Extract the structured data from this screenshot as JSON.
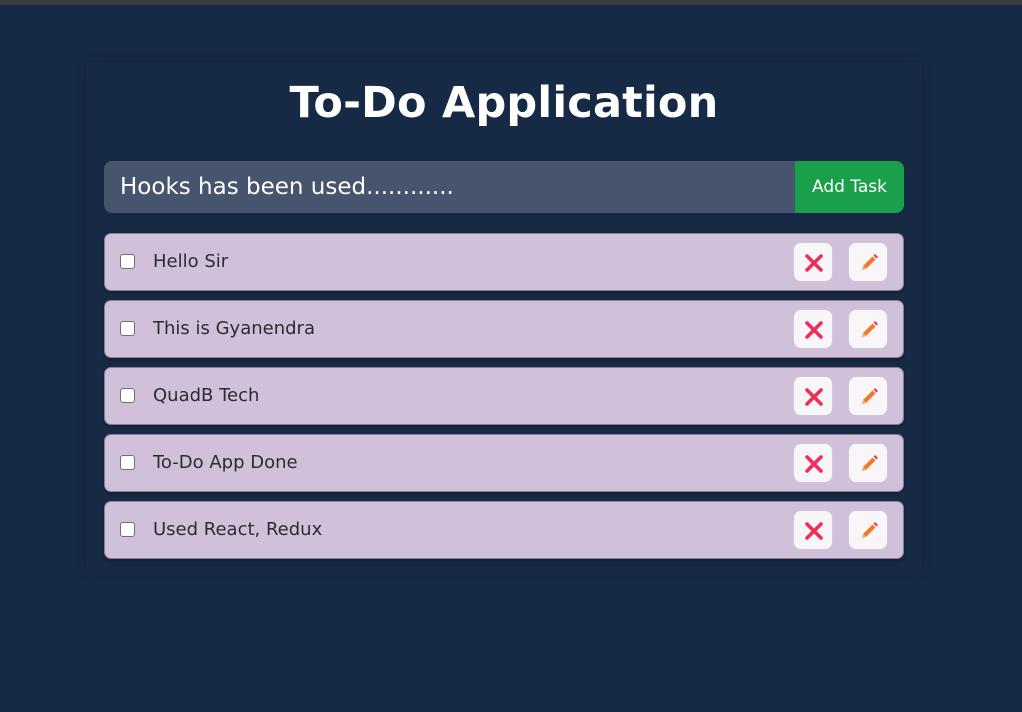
{
  "app": {
    "title": "To-Do Application"
  },
  "input": {
    "value": "Hooks has been used............",
    "add_label": "Add Task"
  },
  "tasks": [
    {
      "text": "Hello Sir",
      "checked": false
    },
    {
      "text": "This is Gyanendra",
      "checked": false
    },
    {
      "text": "QuadB Tech",
      "checked": false
    },
    {
      "text": "To-Do App Done",
      "checked": false
    },
    {
      "text": "Used React, Redux",
      "checked": false
    }
  ],
  "icons": {
    "delete": "close-icon",
    "edit": "pencil-icon"
  },
  "colors": {
    "background": "#172a45",
    "input_bg": "#46546d",
    "add_button": "#1aa04a",
    "task_bg": "#d0c0da",
    "delete_icon": "#ef2f5a",
    "edit_icon": "#f07a2a"
  }
}
